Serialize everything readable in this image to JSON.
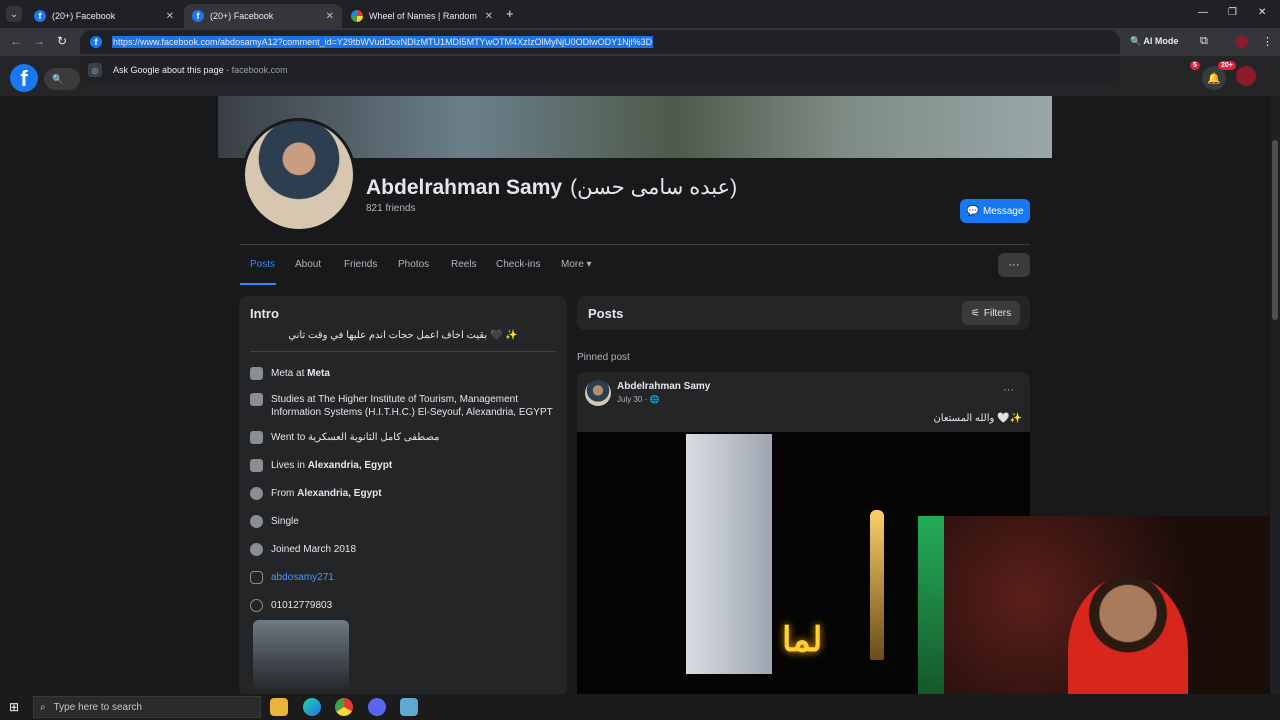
{
  "browser": {
    "tabs": [
      {
        "label": "(20+) Facebook",
        "active": false
      },
      {
        "label": "(20+) Facebook",
        "active": true
      },
      {
        "label": "Wheel of Names | Random nan",
        "active": false
      }
    ],
    "new_tab": "+",
    "url": "https://www.facebook.com/abdosamyA12?comment_id=Y29tbWVudDoxNDIzMTU1MDI5MTYwOTM4XzIzOlMyNjU0ODlwODY1Njl%3D",
    "suggestion": {
      "text": "Ask Google about this page",
      "domain": "facebook.com"
    },
    "ai_mode_label": "AI Mode",
    "window_controls": [
      "—",
      "❐",
      "✕"
    ]
  },
  "facebook": {
    "notifications_badge": "5",
    "account_badge": "20+"
  },
  "profile": {
    "name": "Abdelrahman Samy",
    "alt_name": "(عبده سامى حسن)",
    "friends": "821 friends",
    "message_label": "Message",
    "tabs": [
      "Posts",
      "About",
      "Friends",
      "Photos",
      "Reels",
      "Check-ins",
      "More ▾"
    ],
    "more_label": "···"
  },
  "intro": {
    "title": "Intro",
    "bio": "بقيت اخاف اعمل حجات اندم عليها في وقت تاني 🖤 ✨",
    "work_prefix": "Meta at ",
    "work_company": "Meta",
    "study": "Studies at The Higher Institute of Tourism, Management Information Systems (H.I.T.H.C.) El-Seyouf, Alexandria, EGYPT",
    "school_prefix": "Went to ",
    "school": "مصطفى كامل الثانوية العسكرية",
    "lives_prefix": "Lives in ",
    "lives": "Alexandria, Egypt",
    "from_prefix": "From ",
    "from": "Alexandria, Egypt",
    "relationship": "Single",
    "joined": "Joined March 2018",
    "instagram": "abdosamy271",
    "whatsapp": "01012779803"
  },
  "posts": {
    "title": "Posts",
    "filters_label": "Filters",
    "pinned_label": "Pinned post",
    "post": {
      "author": "Abdelrahman Samy",
      "date": "July 30 · 🌐",
      "more": "···",
      "text": "والله المستعان 🤍✨",
      "neon_text": "لما"
    }
  },
  "taskbar": {
    "search_placeholder": "Type here to search"
  },
  "colors": {
    "facebook_blue": "#1877f2",
    "link_blue": "#4599ff",
    "notification_red": "#e41e3f"
  }
}
